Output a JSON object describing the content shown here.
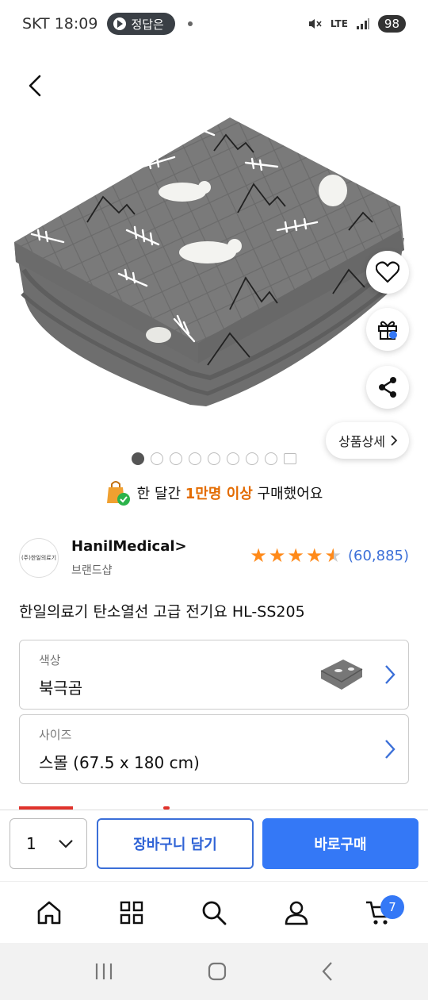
{
  "status_bar": {
    "carrier_time": "SKT 18:09",
    "notification_pill": "정답은",
    "network": "LTE",
    "battery": "98"
  },
  "detail_button_label": "상품상세",
  "image_dots": {
    "count": 8,
    "active_index": 0
  },
  "purchase_banner": {
    "prefix": "한 달간 ",
    "highlight": "1만명 이상",
    "suffix": " 구매했어요"
  },
  "brand": {
    "logo_text": "(주)한일의료기",
    "name": "HanilMedical>",
    "subtitle": "브랜드샵"
  },
  "rating": {
    "stars": 4.5,
    "count": "(60,885)"
  },
  "product_title": "한일의료기 탄소열선 고급 전기요 HL-SS205",
  "options": [
    {
      "label": "색상",
      "value": "북극곰"
    },
    {
      "label": "사이즈",
      "value": "스몰 (67.5 x 180 cm)"
    }
  ],
  "buy_bar": {
    "quantity": "1",
    "cart_label": "장바구니 담기",
    "buy_label": "바로구매"
  },
  "bottom_nav": {
    "cart_badge": "7"
  },
  "colors": {
    "accent": "#3478f6",
    "star": "#ff8a1a",
    "highlight": "#e36b00"
  }
}
